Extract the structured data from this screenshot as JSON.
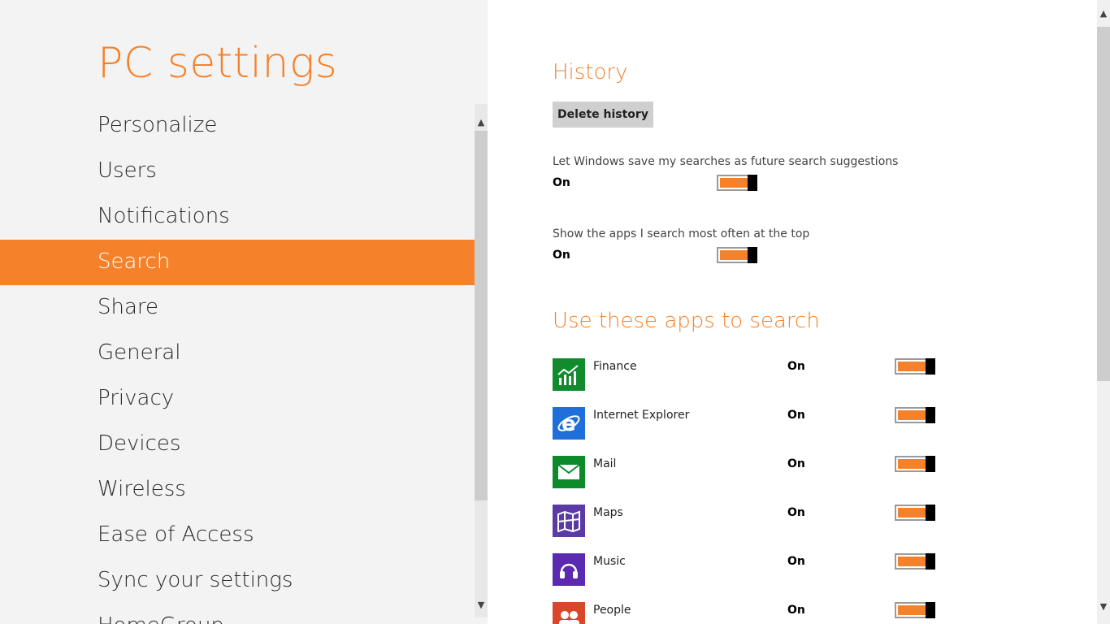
{
  "app": {
    "title": "PC settings"
  },
  "nav": {
    "items": [
      {
        "label": "Personalize",
        "active": false
      },
      {
        "label": "Users",
        "active": false
      },
      {
        "label": "Notifications",
        "active": false
      },
      {
        "label": "Search",
        "active": true
      },
      {
        "label": "Share",
        "active": false
      },
      {
        "label": "General",
        "active": false
      },
      {
        "label": "Privacy",
        "active": false
      },
      {
        "label": "Devices",
        "active": false
      },
      {
        "label": "Wireless",
        "active": false
      },
      {
        "label": "Ease of Access",
        "active": false
      },
      {
        "label": "Sync your settings",
        "active": false
      },
      {
        "label": "HomeGroup",
        "active": false
      }
    ]
  },
  "history": {
    "title": "History",
    "delete_button": "Delete history",
    "settings": [
      {
        "label": "Let Windows save my searches as future search suggestions",
        "state": "On"
      },
      {
        "label": "Show the apps I search most often at the top",
        "state": "On"
      }
    ]
  },
  "apps_section": {
    "title": "Use these apps to search",
    "apps": [
      {
        "name": "Finance",
        "state": "On",
        "icon": "finance-icon",
        "color": "#128b2e"
      },
      {
        "name": "Internet Explorer",
        "state": "On",
        "icon": "internet-explorer-icon",
        "color": "#1e6fd9"
      },
      {
        "name": "Mail",
        "state": "On",
        "icon": "mail-icon",
        "color": "#0d8a2a"
      },
      {
        "name": "Maps",
        "state": "On",
        "icon": "maps-icon",
        "color": "#5b3aa6"
      },
      {
        "name": "Music",
        "state": "On",
        "icon": "music-icon",
        "color": "#5b2ab0"
      },
      {
        "name": "People",
        "state": "On",
        "icon": "people-icon",
        "color": "#d9472b"
      }
    ]
  },
  "theme": {
    "accent": "#f5822a",
    "left_pane_bg": "#f3f3f3"
  }
}
